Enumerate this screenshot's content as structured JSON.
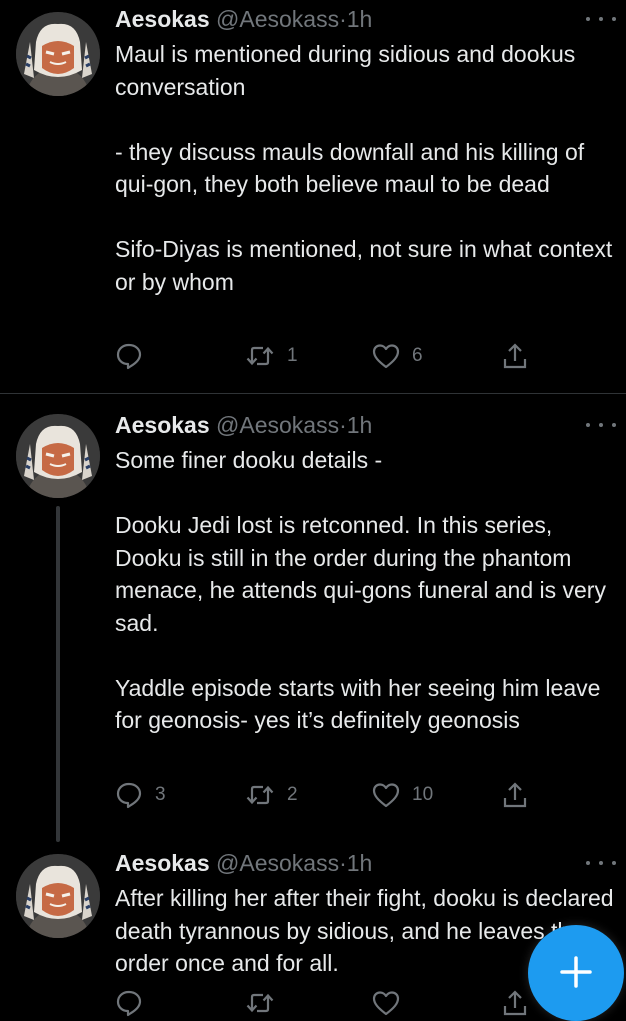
{
  "colors": {
    "background": "#000000",
    "text_primary": "#e7e9ea",
    "text_secondary": "#71767b",
    "accent": "#1d9bf0",
    "divider": "#2f3336"
  },
  "tweets": [
    {
      "author_name": "Aesokas",
      "handle": "@Aesokass",
      "separator": "·",
      "time": "1h",
      "text": "Maul is mentioned during sidious and dookus conversation\n\n- they discuss mauls downfall and his killing of qui-gon, they both believe maul to be dead\n\nSifo-Diyas is mentioned, not sure in what context or by whom",
      "reply_count": "",
      "retweet_count": "1",
      "like_count": "6"
    },
    {
      "author_name": "Aesokas",
      "handle": "@Aesokass",
      "separator": "·",
      "time": "1h",
      "text": "Some finer dooku details -\n\nDooku Jedi lost is retconned. In this series, Dooku is still in the order during the phantom menace, he attends qui-gons funeral and is very sad.\n\nYaddle episode starts with her seeing him leave for geonosis- yes it’s definitely geonosis",
      "reply_count": "3",
      "retweet_count": "2",
      "like_count": "10"
    },
    {
      "author_name": "Aesokas",
      "handle": "@Aesokass",
      "separator": "·",
      "time": "1h",
      "text": "After killing her after their fight, dooku is declared death tyrannous by sidious, and he leaves the order once and for all.",
      "reply_count": "",
      "retweet_count": "",
      "like_count": ""
    }
  ],
  "icons": {
    "reply": "reply-icon",
    "retweet": "retweet-icon",
    "like": "heart-icon",
    "share": "share-icon",
    "more": "more-icon",
    "compose": "compose-plus-icon"
  }
}
